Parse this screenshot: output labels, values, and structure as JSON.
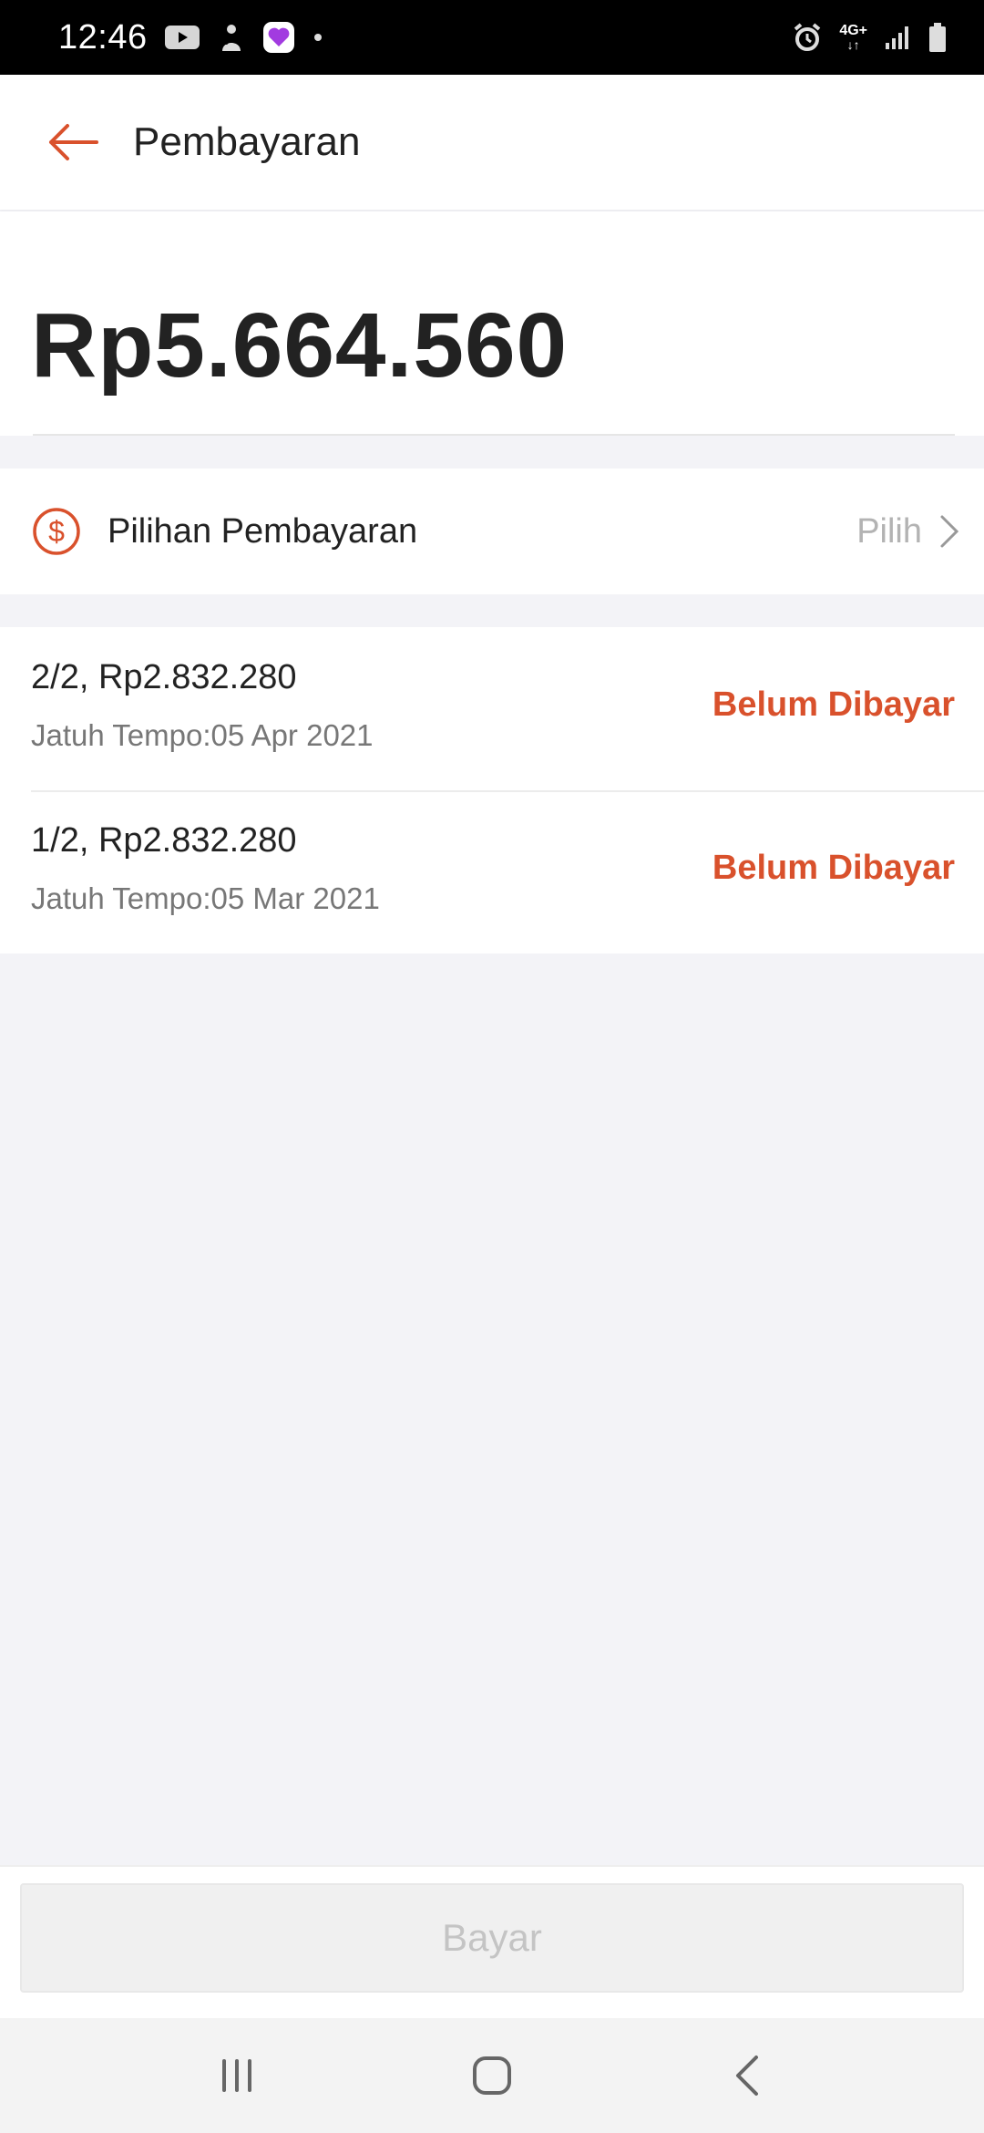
{
  "status_bar": {
    "time": "12:46",
    "network": "4G+",
    "network_arrows": "↓↑",
    "icons": [
      "youtube-icon",
      "notification-app-icon",
      "heart-app-icon",
      "dot-icon",
      "alarm-icon",
      "signal-icon",
      "battery-icon"
    ]
  },
  "header": {
    "title": "Pembayaran",
    "back_icon": "back-arrow-icon"
  },
  "amount": {
    "total": "Rp5.664.560"
  },
  "payment_option": {
    "label": "Pilihan Pembayaran",
    "action": "Pilih",
    "icon": "dollar-circle-icon"
  },
  "installments": [
    {
      "amount": "2/2, Rp2.832.280",
      "due": "Jatuh Tempo:05 Apr 2021",
      "status": "Belum Dibayar"
    },
    {
      "amount": "1/2, Rp2.832.280",
      "due": "Jatuh Tempo:05 Mar 2021",
      "status": "Belum Dibayar"
    }
  ],
  "footer": {
    "pay_button": "Bayar"
  },
  "colors": {
    "accent": "#d9512c",
    "background": "#f3f3f7"
  }
}
